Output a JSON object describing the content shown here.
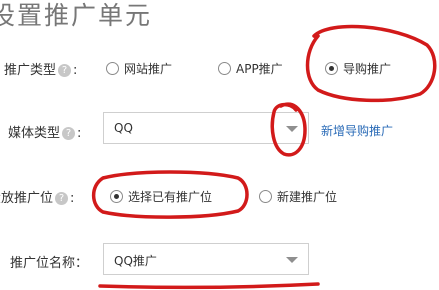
{
  "page": {
    "title": "设置推广单元"
  },
  "promo_type": {
    "label": "推广类型",
    "colon": ":",
    "help": "?",
    "options": [
      {
        "label": "网站推广",
        "selected": false
      },
      {
        "label": "APP推广",
        "selected": false
      },
      {
        "label": "导购推广",
        "selected": true
      }
    ]
  },
  "media_type": {
    "label": "媒体类型",
    "colon": ":",
    "help": "?",
    "value": "QQ",
    "add_link": "新增导购推广"
  },
  "placement": {
    "label": "投放推广位",
    "colon": ":",
    "help": "?",
    "options": [
      {
        "label": "选择已有推广位",
        "selected": true
      },
      {
        "label": "新建推广位",
        "selected": false
      }
    ]
  },
  "placement_name": {
    "label": "推广位名称",
    "colon": "：",
    "value": "QQ推广"
  },
  "annotation_color": "#d21a1a"
}
